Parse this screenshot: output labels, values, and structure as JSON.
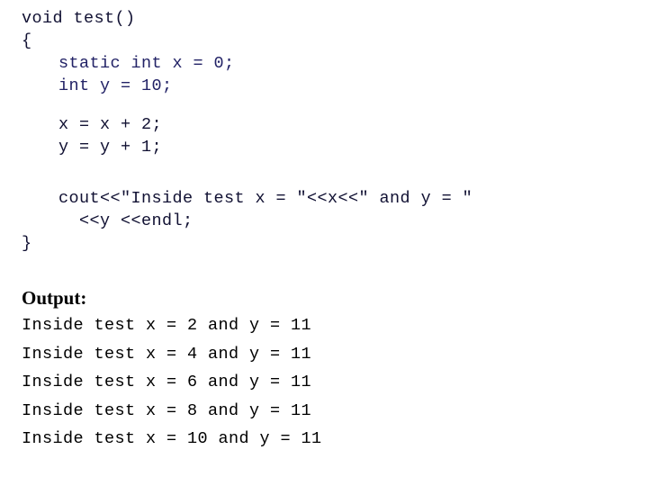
{
  "slide": {
    "background_color": "#ffffff",
    "code_color": "#111133",
    "code_keyword_color": "#222266",
    "output_color": "#000000"
  },
  "code": {
    "lines": [
      {
        "text": "void test()",
        "indent": 0,
        "style": "plain"
      },
      {
        "text": "{",
        "indent": 0,
        "style": "plain"
      },
      {
        "text": "static int x = 0;",
        "indent": 1,
        "style": "navy"
      },
      {
        "text": "int y = 10;",
        "indent": 1,
        "style": "navy"
      },
      {
        "text": "",
        "indent": 0,
        "style": "blank"
      },
      {
        "text": "x = x + 2;",
        "indent": 1,
        "style": "plain"
      },
      {
        "text": "y = y + 1;",
        "indent": 1,
        "style": "plain"
      },
      {
        "text": "",
        "indent": 0,
        "style": "blank"
      },
      {
        "text": "",
        "indent": 0,
        "style": "blank"
      },
      {
        "text": "cout<<\"Inside test x = \"<<x<<\" and y = \"",
        "indent": 1,
        "style": "plain"
      },
      {
        "text": "<<y <<endl;",
        "indent": 2,
        "style": "plain"
      },
      {
        "text": "}",
        "indent": 0,
        "style": "plain"
      }
    ],
    "line_0": "void test()",
    "line_1": "{",
    "line_2": "static int x = 0;",
    "line_3": "int y = 10;",
    "line_4": "x = x + 2;",
    "line_5": "y = y + 1;",
    "line_6": "cout<<\"Inside test x = \"<<x<<\" and y = \"",
    "line_7": "<<y <<endl;",
    "line_8": "}"
  },
  "output": {
    "heading": "Output:",
    "lines": [
      "Inside test x = 2 and y = 11",
      "Inside test x = 4 and y = 11",
      "Inside test x = 6 and y = 11",
      "Inside test x = 8 and y = 11",
      "Inside test x = 10 and y = 11"
    ],
    "line_0": "Inside test x = 2 and y = 11",
    "line_1": "Inside test x = 4 and y = 11",
    "line_2": "Inside test x = 6 and y = 11",
    "line_3": "Inside test x = 8 and y = 11",
    "line_4": "Inside test x = 10 and y = 11"
  }
}
